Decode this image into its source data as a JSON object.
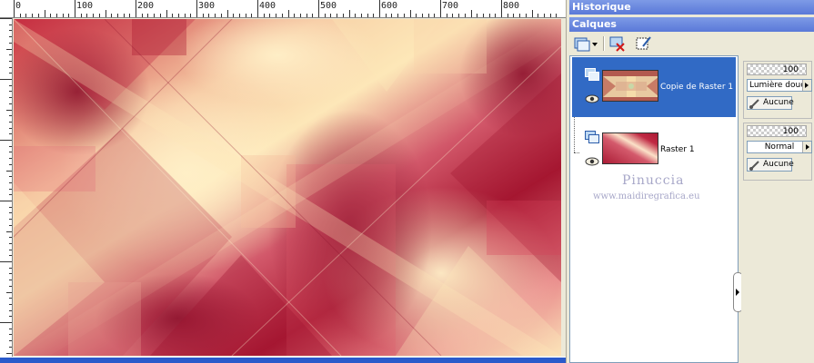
{
  "panels": {
    "history_title": "Historique",
    "layers_title": "Calques"
  },
  "ruler": {
    "labels": [
      "0",
      "100",
      "200",
      "300",
      "400",
      "500",
      "600",
      "700",
      "800"
    ]
  },
  "layers": [
    {
      "name": "Copie de Raster 1",
      "opacity": "100",
      "blend_mode": "Lumière douce",
      "mask": "Aucune",
      "selected": true
    },
    {
      "name": "Raster 1",
      "opacity": "100",
      "blend_mode": "Normal",
      "mask": "Aucune",
      "selected": false
    }
  ],
  "watermark": {
    "name": "Pinuccia",
    "url": "www.maidiregrafica.eu"
  },
  "colors": {
    "panel_bg": "#ece9d8",
    "titlebar": "#6b8be0",
    "selected_row": "#316ac5",
    "crimson": "#b01e3a",
    "cream": "#fde7b8"
  },
  "icons": [
    "new-layer-icon",
    "delete-layer-icon",
    "layer-properties-icon",
    "group-icon",
    "eye-icon",
    "brush-icon"
  ]
}
